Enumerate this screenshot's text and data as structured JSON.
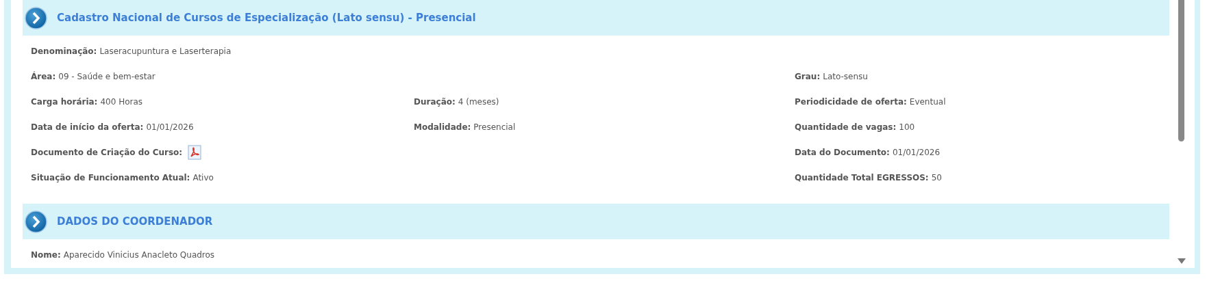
{
  "sections": [
    {
      "title": "Cadastro Nacional de Cursos de Especialização (Lato sensu) - Presencial",
      "rows": [
        [
          {
            "kind": "text",
            "label": "Denominação:",
            "value": "Laseracupuntura e Laserterapia"
          },
          null,
          null
        ],
        [
          {
            "kind": "text",
            "label": "Área:",
            "value": "09 - Saúde e bem-estar"
          },
          null,
          {
            "kind": "text",
            "label": "Grau:",
            "value": "Lato-sensu"
          }
        ],
        [
          {
            "kind": "text",
            "label": "Carga horária:",
            "value": "400 Horas"
          },
          {
            "kind": "text",
            "label": "Duração:",
            "value": "4 (meses)"
          },
          {
            "kind": "text",
            "label": "Periodicidade de oferta:",
            "value": "Eventual"
          }
        ],
        [
          {
            "kind": "text",
            "label": "Data de início da oferta:",
            "value": "01/01/2026"
          },
          {
            "kind": "text",
            "label": "Modalidade:",
            "value": "Presencial"
          },
          {
            "kind": "text",
            "label": "Quantidade de vagas:",
            "value": "100"
          }
        ],
        [
          {
            "kind": "document",
            "label": "Documento de Criação do Curso:"
          },
          null,
          {
            "kind": "text",
            "label": "Data do Documento:",
            "value": "01/01/2026"
          }
        ],
        [
          {
            "kind": "text",
            "label": "Situação de Funcionamento Atual:",
            "value": "Ativo"
          },
          null,
          {
            "kind": "text",
            "label": "Quantidade Total EGRESSOS:",
            "value": "50"
          }
        ]
      ]
    },
    {
      "title": "DADOS DO COORDENADOR",
      "rows": [
        [
          {
            "kind": "text",
            "label": "Nome:",
            "value": "Aparecido Vinicius Anacleto Quadros"
          },
          null,
          null
        ]
      ]
    }
  ]
}
